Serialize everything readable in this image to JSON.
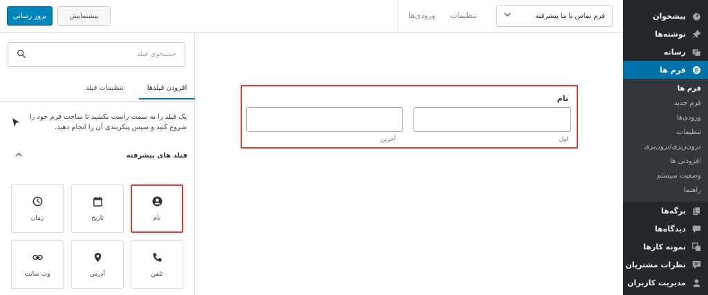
{
  "sidebar": {
    "items_top": [
      {
        "label": "پیشخوان",
        "icon": "dashboard-icon"
      },
      {
        "label": "نوشته‌ها",
        "icon": "pin-icon"
      },
      {
        "label": "رسانه",
        "icon": "media-icon"
      }
    ],
    "active": {
      "label": "فرم ها",
      "icon": "forms-icon"
    },
    "submenu": [
      "فرم ها",
      "فرم جدید",
      "ورودی‌ها",
      "تنظیمات",
      "درون‌ریزی/برون‌بری",
      "افزودنی ها",
      "وضعیت سیستم",
      "راهنما"
    ],
    "items_bottom": [
      {
        "label": "برگه‌ها",
        "icon": "pages-icon"
      },
      {
        "label": "دیدگاه‌ها",
        "icon": "comments-icon"
      },
      {
        "label": "نمونه کارها",
        "icon": "portfolio-icon"
      },
      {
        "label": "نظرات مشتریان",
        "icon": "testimonials-icon"
      },
      {
        "label": "مدیریت کاربران",
        "icon": "users-icon"
      }
    ]
  },
  "topbar": {
    "update_label": "بروز رسانی",
    "preview_label": "پیشنمایش",
    "tab_entries": "ورودی‌ها",
    "tab_settings": "تنظیمات",
    "form_select_value": "فرم تماس با ما پیشرفته"
  },
  "panel": {
    "search_placeholder": "جستجوی فیلد",
    "tab_add": "افزودن فیلدها",
    "tab_settings": "تنظیمات فیلد",
    "help_text": "یک فیلد را به سمت راست بکشید تا ساخت فرم خود را شروع کنید و سپس پیکربندی آن را انجام دهید.",
    "advanced_title": "فیلد های پیشرفته",
    "cards": [
      {
        "label": "نام",
        "icon": "user-icon",
        "highlighted": true
      },
      {
        "label": "تاریخ",
        "icon": "calendar-icon",
        "highlighted": false
      },
      {
        "label": "زمان",
        "icon": "clock-icon",
        "highlighted": false
      },
      {
        "label": "تلفن",
        "icon": "phone-icon",
        "highlighted": false
      },
      {
        "label": "آدرس",
        "icon": "location-pin-icon",
        "highlighted": false
      },
      {
        "label": "وب سایت",
        "icon": "link-icon",
        "highlighted": false
      }
    ]
  },
  "canvas": {
    "field_title": "نام",
    "first_label": "اول",
    "last_label": "آخرین"
  },
  "colors": {
    "sidebar_bg": "#23282d",
    "accent": "#0073aa",
    "highlight": "#e53935"
  }
}
